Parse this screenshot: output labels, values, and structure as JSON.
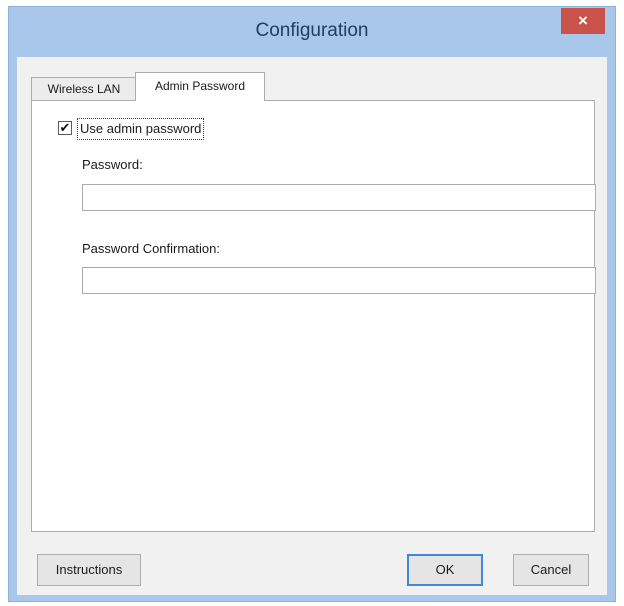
{
  "window": {
    "title": "Configuration",
    "close_glyph": "×"
  },
  "tabs": [
    {
      "label": "Wireless LAN",
      "active": false
    },
    {
      "label": "Admin Password",
      "active": true
    }
  ],
  "admin_password": {
    "use_admin_password": {
      "label": "Use admin password",
      "checked": true,
      "check_glyph": "✔"
    },
    "password": {
      "label": "Password:",
      "value": "",
      "placeholder": ""
    },
    "password_confirmation": {
      "label": "Password Confirmation:",
      "value": "",
      "placeholder": ""
    }
  },
  "buttons": {
    "instructions": "Instructions",
    "ok": "OK",
    "cancel": "Cancel"
  },
  "colors": {
    "title_bar": "#a9c7ea",
    "close_button": "#c9524a",
    "default_button_border": "#3c8ad8"
  }
}
